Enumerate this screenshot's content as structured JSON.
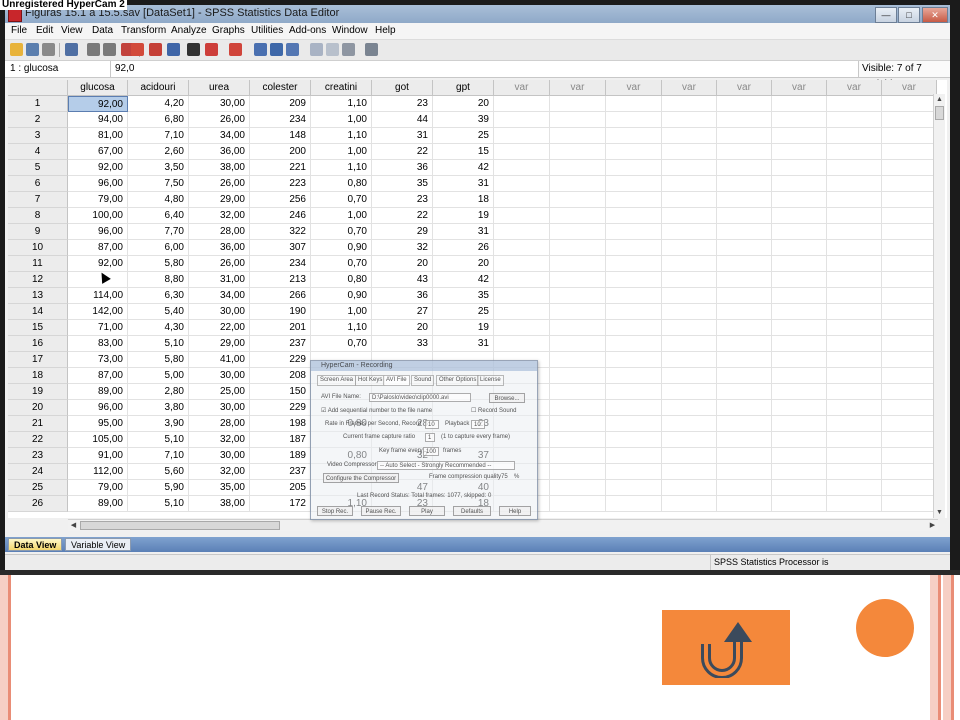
{
  "overlay_label": "Unregistered HyperCam 2",
  "window": {
    "title": "Figuras 15.1 a 15.5.sav [DataSet1] - SPSS Statistics Data Editor"
  },
  "menu": [
    "File",
    "Edit",
    "View",
    "Data",
    "Transform",
    "Analyze",
    "Graphs",
    "Utilities",
    "Add-ons",
    "Window",
    "Help"
  ],
  "editbar": {
    "cell_ref": "1 : glucosa",
    "cell_value": "92,0",
    "visible": "Visible: 7 of 7 Variables"
  },
  "columns": [
    "glucosa",
    "acidouri",
    "urea",
    "colester",
    "creatini",
    "got",
    "gpt",
    "var",
    "var",
    "var",
    "var",
    "var",
    "var",
    "var",
    "var"
  ],
  "rows": [
    [
      "1",
      "92,00",
      "4,20",
      "30,00",
      "209",
      "1,10",
      "23",
      "20"
    ],
    [
      "2",
      "94,00",
      "6,80",
      "26,00",
      "234",
      "1,00",
      "44",
      "39"
    ],
    [
      "3",
      "81,00",
      "7,10",
      "34,00",
      "148",
      "1,10",
      "31",
      "25"
    ],
    [
      "4",
      "67,00",
      "2,60",
      "36,00",
      "200",
      "1,00",
      "22",
      "15"
    ],
    [
      "5",
      "92,00",
      "3,50",
      "38,00",
      "221",
      "1,10",
      "36",
      "42"
    ],
    [
      "6",
      "96,00",
      "7,50",
      "26,00",
      "223",
      "0,80",
      "35",
      "31"
    ],
    [
      "7",
      "79,00",
      "4,80",
      "29,00",
      "256",
      "0,70",
      "23",
      "18"
    ],
    [
      "8",
      "100,00",
      "6,40",
      "32,00",
      "246",
      "1,00",
      "22",
      "19"
    ],
    [
      "9",
      "96,00",
      "7,70",
      "28,00",
      "322",
      "0,70",
      "29",
      "31"
    ],
    [
      "10",
      "87,00",
      "6,00",
      "36,00",
      "307",
      "0,90",
      "32",
      "26"
    ],
    [
      "11",
      "92,00",
      "5,80",
      "26,00",
      "234",
      "0,70",
      "20",
      "20"
    ],
    [
      "12",
      "",
      "8,80",
      "31,00",
      "213",
      "0,80",
      "43",
      "42"
    ],
    [
      "13",
      "114,00",
      "6,30",
      "34,00",
      "266",
      "0,90",
      "36",
      "35"
    ],
    [
      "14",
      "142,00",
      "5,40",
      "30,00",
      "190",
      "1,00",
      "27",
      "25"
    ],
    [
      "15",
      "71,00",
      "4,30",
      "22,00",
      "201",
      "1,10",
      "20",
      "19"
    ],
    [
      "16",
      "83,00",
      "5,10",
      "29,00",
      "237",
      "0,70",
      "33",
      "31"
    ],
    [
      "17",
      "73,00",
      "5,80",
      "41,00",
      "229",
      "",
      "",
      ""
    ],
    [
      "18",
      "87,00",
      "5,00",
      "30,00",
      "208",
      "",
      "",
      ""
    ],
    [
      "19",
      "89,00",
      "2,80",
      "25,00",
      "150",
      "",
      "",
      ""
    ],
    [
      "20",
      "96,00",
      "3,80",
      "30,00",
      "229",
      "",
      "",
      ""
    ],
    [
      "21",
      "95,00",
      "3,90",
      "28,00",
      "198",
      "0,80",
      "28",
      "23"
    ],
    [
      "22",
      "105,00",
      "5,10",
      "32,00",
      "187",
      "",
      "",
      ""
    ],
    [
      "23",
      "91,00",
      "7,10",
      "30,00",
      "189",
      "0,80",
      "32",
      "37"
    ],
    [
      "24",
      "112,00",
      "5,60",
      "32,00",
      "237",
      "",
      "",
      ""
    ],
    [
      "25",
      "79,00",
      "5,90",
      "35,00",
      "205",
      "",
      "47",
      "40"
    ],
    [
      "26",
      "89,00",
      "5,10",
      "38,00",
      "172",
      "1,10",
      "23",
      "18"
    ]
  ],
  "tabs": [
    "Data View",
    "Variable View"
  ],
  "status": "SPSS Statistics  Processor is ready",
  "dialog": {
    "title": "HyperCam - Recording",
    "tabs": [
      "Screen Area",
      "Hot Keys",
      "AVI File",
      "Sound",
      "Other Options",
      "License"
    ],
    "file_label": "AVI File Name:",
    "file_value": "D:\\Paloslo\\video\\clip0000.avi",
    "browse": "Browse...",
    "add_seq": "Add sequential number to the file name",
    "record_sound": "Record Sound",
    "rate_label": "Rate in Frames per Second,  Record",
    "record_val": "10",
    "playback_label": "Playback",
    "playback_val": "10",
    "capture_label": "Current frame capture ratio",
    "capture_val": "1",
    "capture_hint": "(1 to capture every frame)",
    "key_label": "Key frame every",
    "key_val": "100",
    "key_unit": "frames",
    "codec_label": "Video Compressor",
    "codec_value": "-- Auto Select - Strongly Recommended --",
    "configure": "Configure the Compressor",
    "quality_label": "Frame compression quality",
    "quality_val": "75",
    "quality_unit": "%",
    "last_status": "Last Record Status: Total frames: 1077, skipped: 0",
    "buttons": [
      "Stop Rec.",
      "Pause Rec.",
      "Play",
      "Defaults",
      "Help"
    ]
  },
  "colors": {
    "accent": "#f4883b",
    "stripe_light": "#f7d2c8",
    "stripe_dark": "#e98d76"
  },
  "icons": {
    "back": "u-turn-arrow-icon"
  }
}
